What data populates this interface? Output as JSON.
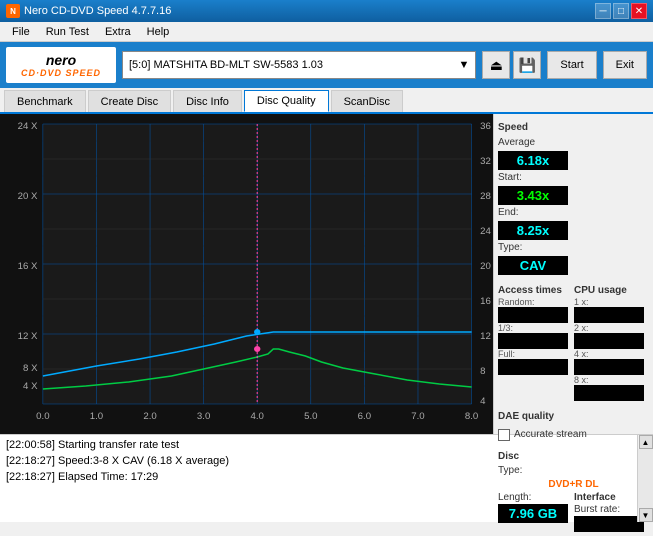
{
  "window": {
    "title": "Nero CD-DVD Speed 4.7.7.16",
    "minimize": "─",
    "maximize": "□",
    "close": "✕"
  },
  "menu": {
    "items": [
      "File",
      "Run Test",
      "Extra",
      "Help"
    ]
  },
  "toolbar": {
    "logo_nero": "nero",
    "logo_cd": "CD·DVD SPEED",
    "drive_label": "[5:0]  MATSHITA BD-MLT SW-5583 1.03",
    "start_btn": "Start",
    "exit_btn": "Exit"
  },
  "tabs": [
    {
      "label": "Benchmark",
      "active": false
    },
    {
      "label": "Create Disc",
      "active": false
    },
    {
      "label": "Disc Info",
      "active": false
    },
    {
      "label": "Disc Quality",
      "active": true
    },
    {
      "label": "ScanDisc",
      "active": false
    }
  ],
  "chart": {
    "y_axis_left": [
      "24 X",
      "20 X",
      "16 X",
      "12 X",
      "8 X",
      "4 X"
    ],
    "y_axis_right": [
      "36",
      "32",
      "28",
      "24",
      "20",
      "16",
      "12",
      "8",
      "4"
    ],
    "x_axis": [
      "0.0",
      "1.0",
      "2.0",
      "3.0",
      "4.0",
      "5.0",
      "6.0",
      "7.0",
      "8.0"
    ]
  },
  "right_panel": {
    "speed_section": "Speed",
    "average_label": "Average",
    "average_value": "6.18x",
    "start_label": "Start:",
    "start_value": "3.43x",
    "end_label": "End:",
    "end_value": "8.25x",
    "type_label": "Type:",
    "type_value": "CAV",
    "access_times": "Access times",
    "random_label": "Random:",
    "one_third_label": "1/3:",
    "full_label": "Full:",
    "cpu_usage": "CPU usage",
    "cpu_1x": "1 x:",
    "cpu_2x": "2 x:",
    "cpu_4x": "4 x:",
    "cpu_8x": "8 x:",
    "dae_quality": "DAE quality",
    "accurate_stream": "Accurate stream",
    "disc_section": "Disc",
    "disc_type_label": "Type:",
    "disc_type_value": "DVD+R DL",
    "disc_length_label": "Length:",
    "disc_length_value": "7.96 GB",
    "interface_label": "Interface",
    "burst_rate_label": "Burst rate:"
  },
  "log": {
    "lines": [
      "[22:00:58]  Starting transfer rate test",
      "[22:18:27]  Speed:3-8 X CAV (6.18 X average)",
      "[22:18:27]  Elapsed Time: 17:29"
    ]
  }
}
